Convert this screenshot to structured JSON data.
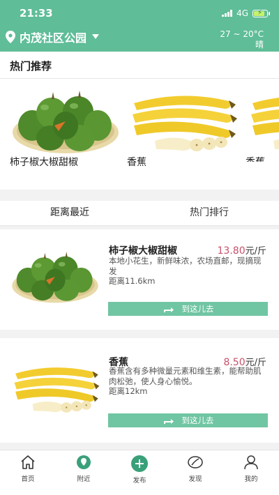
{
  "status": {
    "time": "21:33",
    "network": "4G"
  },
  "header": {
    "location": "内茂社区公园",
    "temperature": "27 ~ 20°C",
    "weather": "晴"
  },
  "hot": {
    "title": "热门推荐",
    "items": [
      {
        "name": "柿子椒大椒甜椒",
        "image": "pepper"
      },
      {
        "name": "香蕉",
        "image": "banana"
      },
      {
        "name": "香蕉",
        "image": "banana"
      }
    ]
  },
  "tabs": {
    "items": [
      "距离最近",
      "热门排行"
    ],
    "active": "距离最近"
  },
  "products": [
    {
      "name": "柿子椒大椒甜椒",
      "price": "13.80",
      "unit": "元/斤",
      "desc": "本地小花生，新鲜味浓，农场直邮，现摘现发",
      "distance": "距离11.6km",
      "button": "到这儿去",
      "image": "pepper"
    },
    {
      "name": "香蕉",
      "price": "8.50",
      "unit": "元/斤",
      "desc": "香蕉含有多种微量元素和维生素，能帮助肌肉松弛，使人身心愉悦。",
      "distance": "距离12km",
      "button": "到这儿去",
      "image": "banana"
    }
  ],
  "tabbar": {
    "items": [
      {
        "label": "首页",
        "icon": "home-icon"
      },
      {
        "label": "附近",
        "icon": "nearby-icon"
      },
      {
        "label": "发布",
        "icon": "publish-icon"
      },
      {
        "label": "发现",
        "icon": "discover-icon"
      },
      {
        "label": "我的",
        "icon": "profile-icon"
      }
    ]
  },
  "colors": {
    "primary": "#5fbd98",
    "button": "#70c5a3",
    "price": "#c8506a",
    "tabbar_green": "#3aa07a"
  }
}
